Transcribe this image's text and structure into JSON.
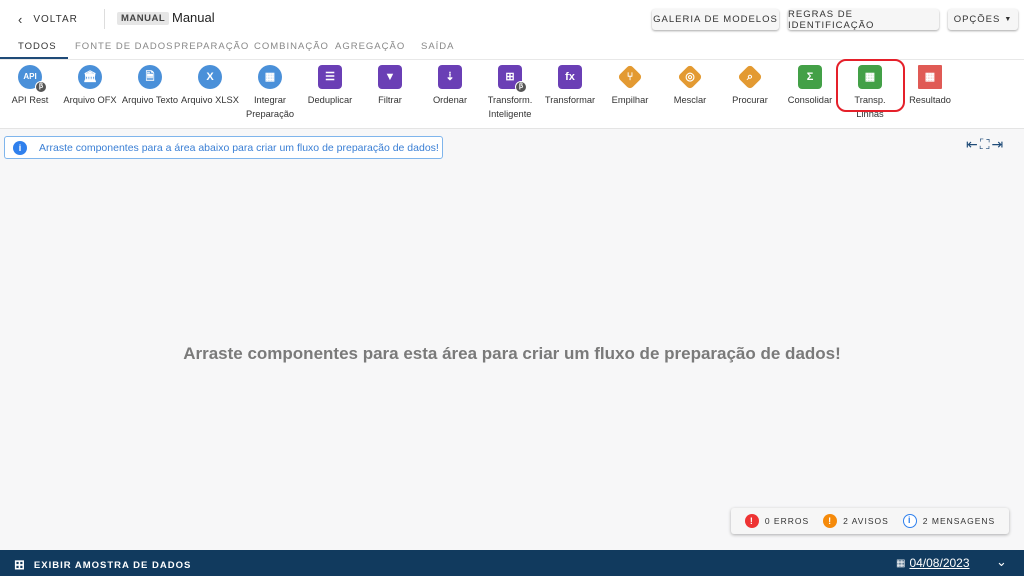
{
  "header": {
    "back_label": "VOLTAR",
    "badge": "MANUAL",
    "title": "Manual",
    "buttons": [
      "GALERIA DE MODELOS",
      "REGRAS DE IDENTIFICAÇÃO",
      "OPÇÕES"
    ]
  },
  "tabs": [
    "TODOS",
    "FONTE DE DADOS",
    "PREPARAÇÃO",
    "COMBINAÇÃO",
    "AGREGAÇÃO",
    "SAÍDA"
  ],
  "active_tab": "TODOS",
  "tools": [
    {
      "label": "API Rest",
      "icon": "api-icon",
      "glyph": "API",
      "beta": true
    },
    {
      "label": "Arquivo OFX",
      "icon": "bank-icon",
      "glyph": "🏛"
    },
    {
      "label": "Arquivo Texto",
      "icon": "text-file-icon",
      "glyph": "🗎"
    },
    {
      "label": "Arquivo XLSX",
      "icon": "xlsx-file-icon",
      "glyph": "X"
    },
    {
      "label": "Integrar Preparação",
      "icon": "grid-icon",
      "glyph": "▦"
    },
    {
      "label": "Deduplicar",
      "icon": "list-icon",
      "glyph": "☰"
    },
    {
      "label": "Filtrar",
      "icon": "filter-icon",
      "glyph": "▼"
    },
    {
      "label": "Ordenar",
      "icon": "sort-icon",
      "glyph": "⇣"
    },
    {
      "label": "Transform. Inteligente",
      "icon": "smart-transform-icon",
      "glyph": "⊞",
      "beta": true
    },
    {
      "label": "Transformar",
      "icon": "function-icon",
      "glyph": "fx"
    },
    {
      "label": "Empilhar",
      "icon": "stack-icon",
      "glyph": "⑂"
    },
    {
      "label": "Mesclar",
      "icon": "merge-icon",
      "glyph": "◎"
    },
    {
      "label": "Procurar",
      "icon": "lookup-icon",
      "glyph": "⌕"
    },
    {
      "label": "Consolidar",
      "icon": "sigma-icon",
      "glyph": "Σ"
    },
    {
      "label": "Transp. Linhas",
      "icon": "transpose-icon",
      "glyph": "▦"
    },
    {
      "label": "Resultado",
      "icon": "result-table-icon",
      "glyph": "▦"
    }
  ],
  "beta_glyph": "β",
  "colors": {
    "source": "#4a90d9",
    "prep": "#6a3fb5",
    "combine": "#e39a32",
    "aggregate": "#43a047",
    "output": "#e05a55",
    "highlight": "#e5202a",
    "bottom_bar": "#113a5e"
  },
  "info_message": "Arraste componentes para a área abaixo para criar um fluxo de preparação de dados!",
  "canvas_message": "Arraste componentes para esta área para criar um fluxo de preparação de dados!",
  "status": {
    "errors": "0 ERROS",
    "warnings": "2 AVISOS",
    "messages": "2 MENSAGENS"
  },
  "bottom": {
    "label": "EXIBIR AMOSTRA DE DADOS",
    "date": "04/08/2023"
  }
}
